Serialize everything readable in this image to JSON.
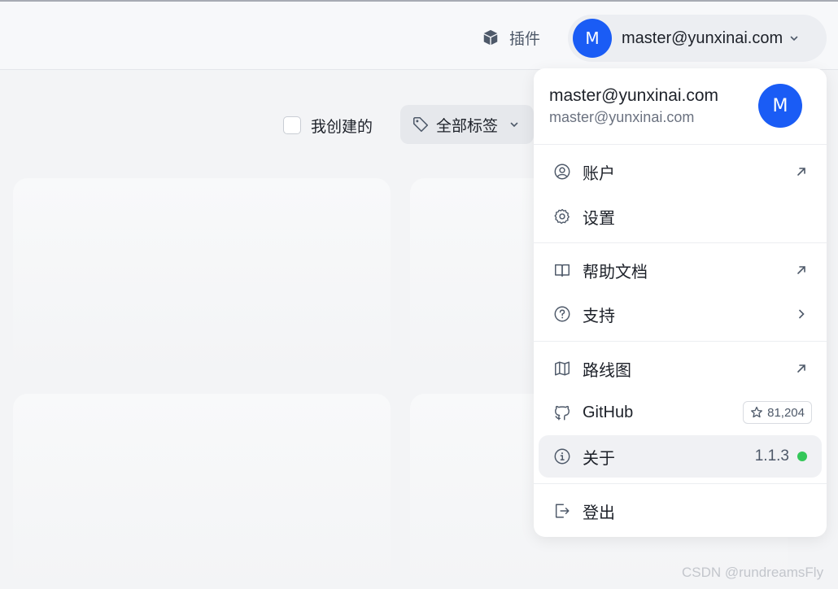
{
  "header": {
    "plugins_label": "插件",
    "user_email": "master@yunxinai.com",
    "avatar_letter": "M"
  },
  "filters": {
    "mine_label": "我创建的",
    "mine_checked": false,
    "tags_label": "全部标签"
  },
  "menu": {
    "name": "master@yunxinai.com",
    "email": "master@yunxinai.com",
    "avatar_letter": "M",
    "items": {
      "account": "账户",
      "settings": "设置",
      "docs": "帮助文档",
      "support": "支持",
      "roadmap": "路线图",
      "github": "GitHub",
      "github_stars": "81,204",
      "about": "关于",
      "version": "1.1.3",
      "logout": "登出"
    }
  },
  "colors": {
    "accent": "#1a5cf5",
    "status_online": "#34c759"
  },
  "watermark": "CSDN @rundreamsFly"
}
